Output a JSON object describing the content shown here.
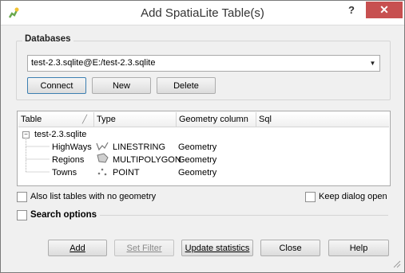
{
  "window": {
    "title": "Add SpatiaLite Table(s)",
    "help_label": "?",
    "close_label": "✕"
  },
  "databases": {
    "group_title": "Databases",
    "selected": "test-2.3.sqlite@E:/test-2.3.sqlite",
    "buttons": {
      "connect": "Connect",
      "new": "New",
      "delete": "Delete"
    }
  },
  "tree": {
    "headers": [
      "Table",
      "Type",
      "Geometry column",
      "Sql"
    ],
    "root": "test-2.3.sqlite",
    "rows": [
      {
        "table": "HighWays",
        "type": "LINESTRING",
        "geometry": "Geometry",
        "icon": "linestring-icon"
      },
      {
        "table": "Regions",
        "type": "MULTIPOLYGON",
        "geometry": "Geometry",
        "icon": "polygon-icon"
      },
      {
        "table": "Towns",
        "type": "POINT",
        "geometry": "Geometry",
        "icon": "point-icon"
      }
    ]
  },
  "options": {
    "no_geometry": "Also list tables with no geometry",
    "keep_open": "Keep dialog open",
    "search_options": "Search options"
  },
  "buttons": {
    "add": "Add",
    "set_filter": "Set Filter",
    "update_statistics": "Update statistics",
    "close": "Close",
    "help": "Help"
  }
}
